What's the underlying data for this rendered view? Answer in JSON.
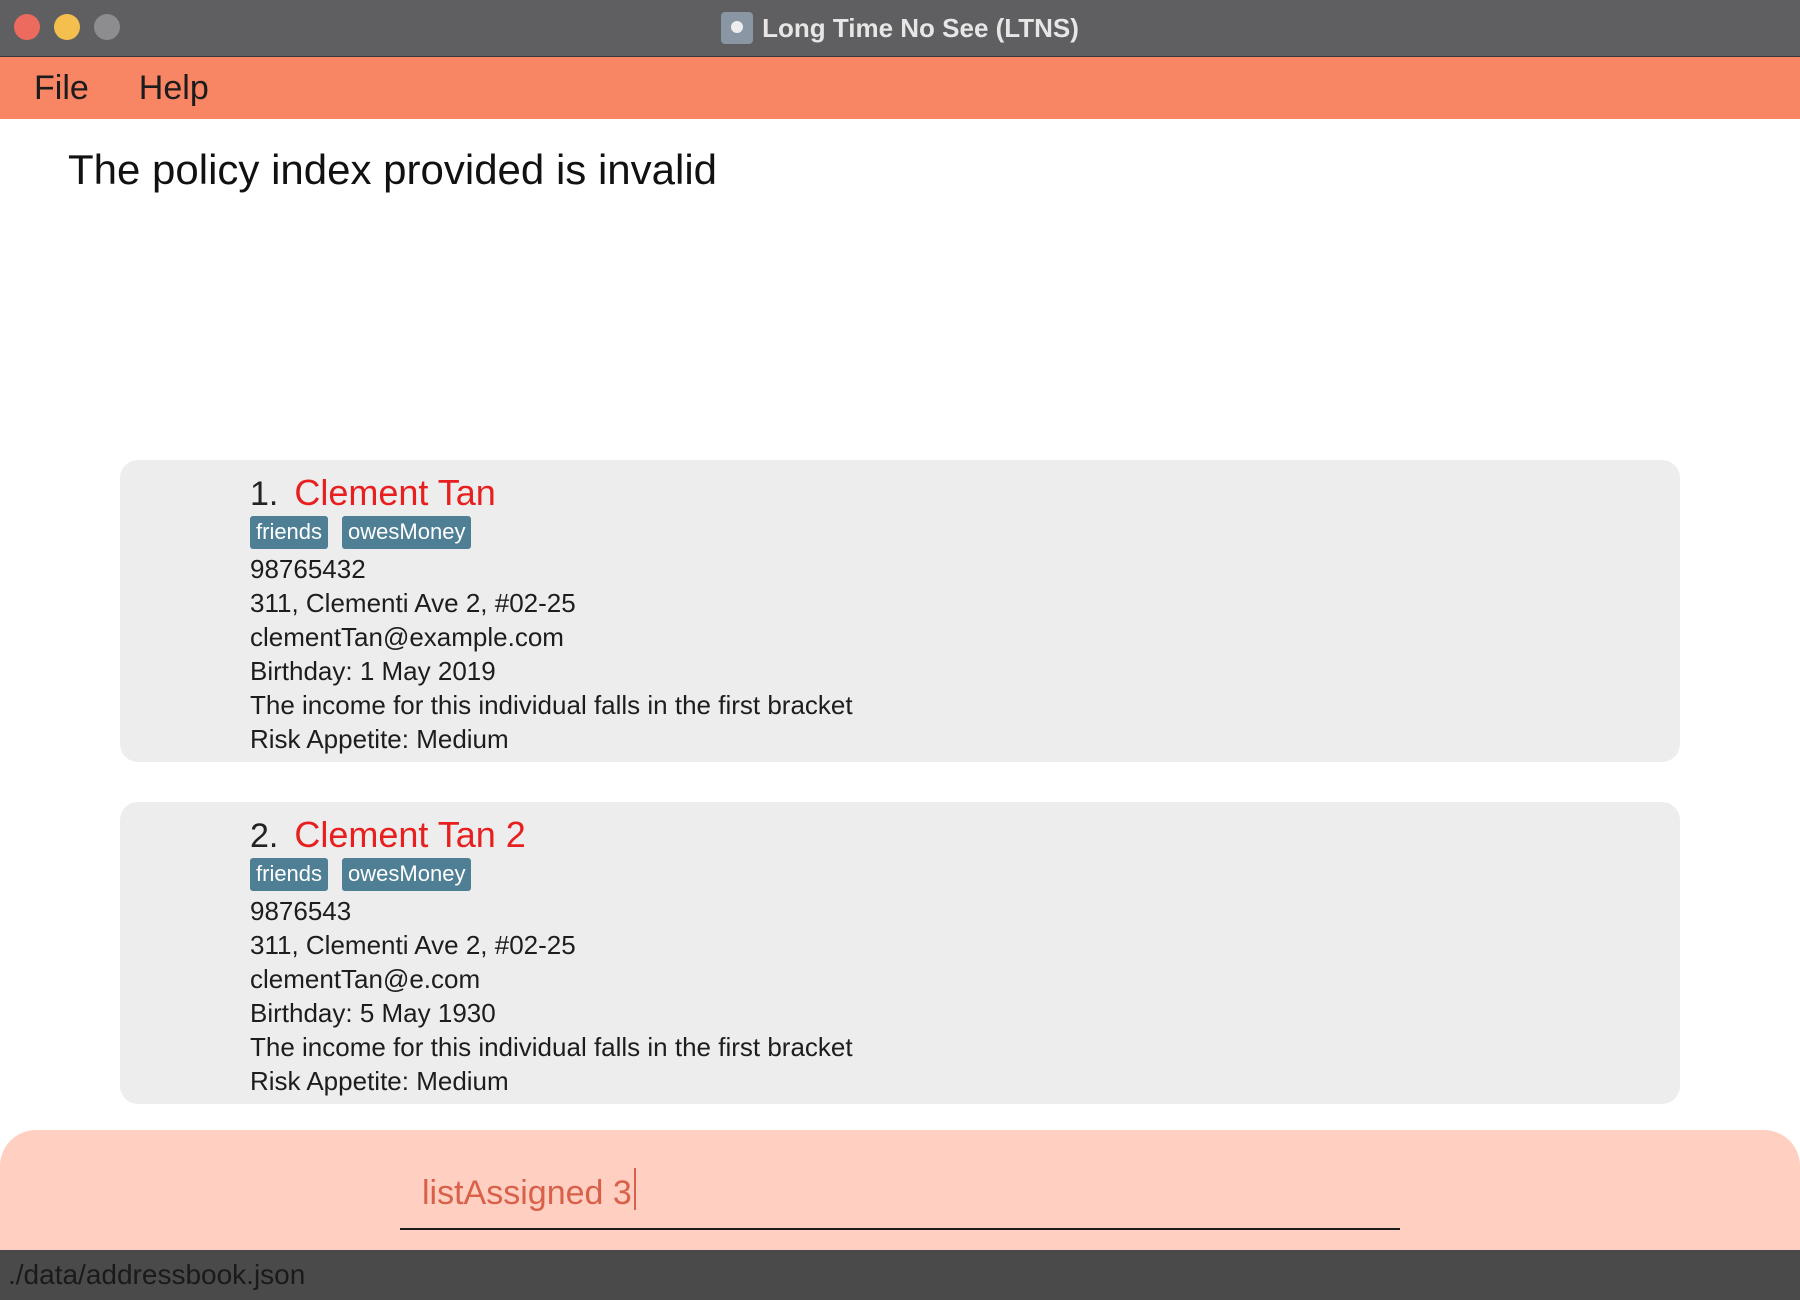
{
  "window": {
    "title": "Long Time No See (LTNS)",
    "app_icon": "ltns-app-icon"
  },
  "menu": {
    "items": [
      {
        "label": "File"
      },
      {
        "label": "Help"
      }
    ]
  },
  "result_display": {
    "message": "The policy index provided is invalid"
  },
  "persons": [
    {
      "index": "1.",
      "name": "Clement Tan",
      "tags": [
        "friends",
        "owesMoney"
      ],
      "phone": "98765432",
      "address": "311, Clementi Ave 2, #02-25",
      "email": "clementTan@example.com",
      "birthday": "Birthday: 1 May 2019",
      "income": "The income for this individual falls in the first bracket",
      "risk": "Risk Appetite: Medium"
    },
    {
      "index": "2.",
      "name": "Clement Tan 2",
      "tags": [
        "friends",
        "owesMoney"
      ],
      "phone": "9876543",
      "address": "311, Clementi Ave 2, #02-25",
      "email": "clementTan@e.com",
      "birthday": "Birthday: 5 May 1930",
      "income": "The income for this individual falls in the first bracket",
      "risk": "Risk Appetite: Medium"
    }
  ],
  "command_box": {
    "value": "listAssigned 3"
  },
  "status_bar": {
    "path": "./data/addressbook.json"
  },
  "colors": {
    "menu_bar": "#f88563",
    "command_area": "#ffcfc1",
    "name_text": "#e81f1f",
    "tag_bg": "#4f7f95"
  }
}
